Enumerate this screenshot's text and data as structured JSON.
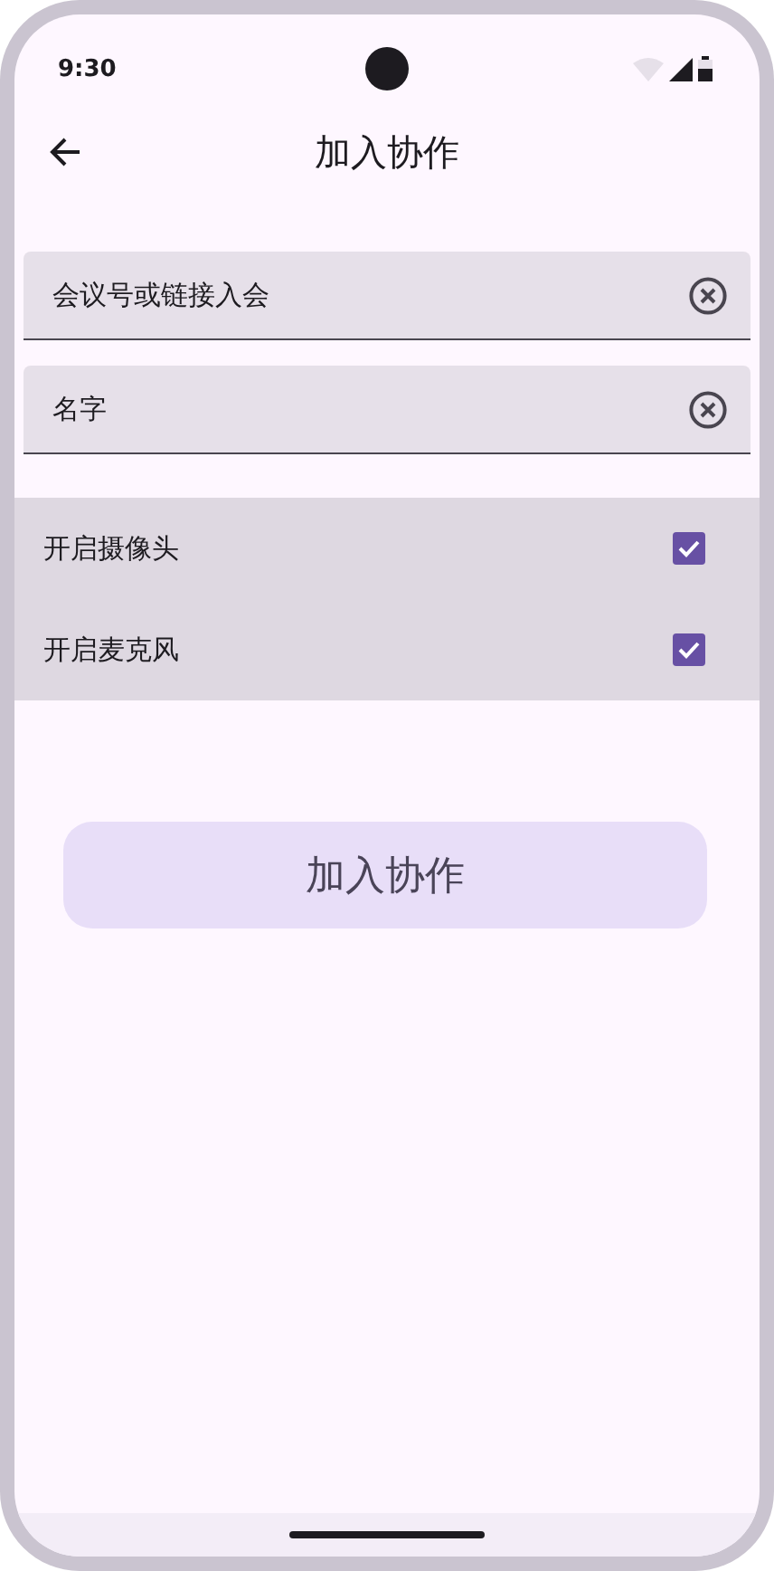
{
  "status_bar": {
    "time": "9:30"
  },
  "app_bar": {
    "title": "加入协作"
  },
  "fields": [
    {
      "value": "会议号或链接入会"
    },
    {
      "value": "名字"
    }
  ],
  "options": [
    {
      "label": "开启摄像头",
      "checked": true
    },
    {
      "label": "开启麦克风",
      "checked": true
    }
  ],
  "join_button": {
    "label": "加入协作"
  }
}
